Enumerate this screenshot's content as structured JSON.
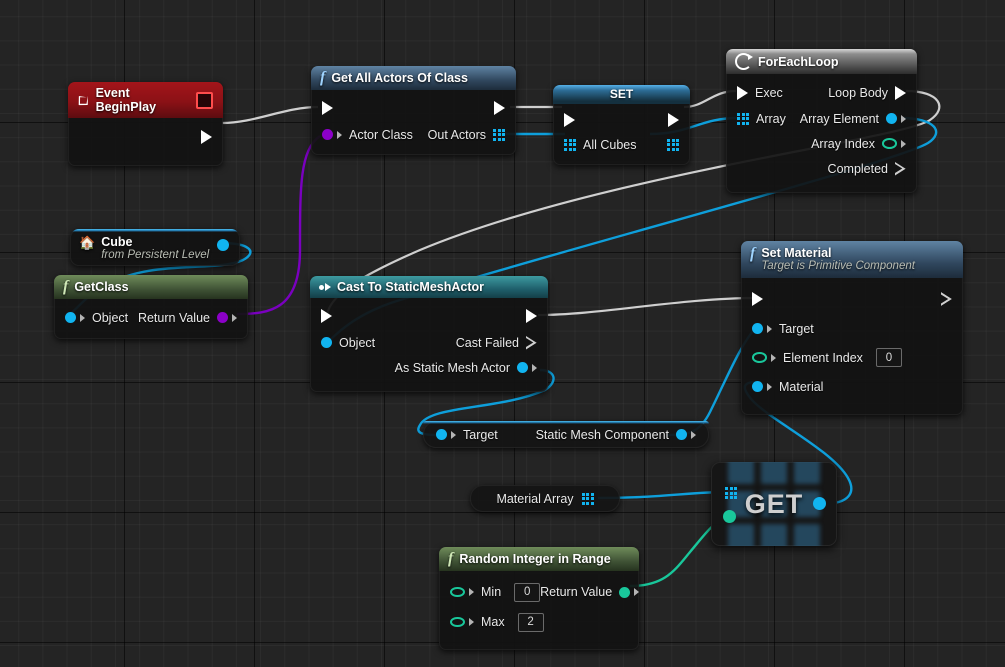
{
  "app": {
    "title": "Unreal Engine Blueprint Event Graph"
  },
  "nodes": {
    "event_begin_play": {
      "title": "Event BeginPlay",
      "icon": "event-diamond-icon",
      "breakpoint_icon": "stop-square-icon",
      "exec_out": ""
    },
    "get_all_actors": {
      "title": "Get All Actors Of Class",
      "icon": "function-f-icon",
      "inputs": [
        {
          "label": "Actor Class",
          "pin": "class-pin"
        }
      ],
      "outputs": [
        {
          "label": "Out Actors",
          "pin": "array-pin"
        }
      ]
    },
    "set_all_cubes": {
      "title": "SET",
      "var_label": "All Cubes",
      "pin": "array-pin"
    },
    "for_each_loop": {
      "title": "ForEachLoop",
      "icon": "loop-icon",
      "inputs": [
        {
          "label": "Exec",
          "pin": "exec-pin"
        },
        {
          "label": "Array",
          "pin": "array-pin"
        }
      ],
      "outputs": [
        {
          "label": "Loop Body",
          "pin": "exec-pin"
        },
        {
          "label": "Array Element",
          "pin": "object-pin"
        },
        {
          "label": "Array Index",
          "pin": "int-pin"
        },
        {
          "label": "Completed",
          "pin": "exec-pin"
        }
      ]
    },
    "cube_ref": {
      "title": "Cube",
      "subtitle": "from Persistent Level",
      "icon": "level-actor-icon",
      "out_pin": "object-pin"
    },
    "get_class": {
      "title": "GetClass",
      "icon": "function-f-icon",
      "inputs": [
        {
          "label": "Object",
          "pin": "object-pin"
        }
      ],
      "outputs": [
        {
          "label": "Return Value",
          "pin": "class-pin"
        }
      ]
    },
    "cast_node": {
      "title": "Cast To StaticMeshActor",
      "icon": "cast-icon",
      "inputs": [
        {
          "label": "Object",
          "pin": "object-pin"
        }
      ],
      "outputs": [
        {
          "label": "Cast Failed",
          "pin": "exec-pin-hollow"
        },
        {
          "label": "As Static Mesh Actor",
          "pin": "object-pin"
        }
      ]
    },
    "set_material": {
      "title": "Set Material",
      "subtitle": "Target is Primitive Component",
      "icon": "function-f-icon",
      "inputs": [
        {
          "label": "Target",
          "pin": "object-pin",
          "value": null
        },
        {
          "label": "Element Index",
          "pin": "int-pin",
          "value": "0"
        },
        {
          "label": "Material",
          "pin": "object-pin",
          "value": null
        }
      ]
    },
    "static_mesh_component": {
      "input_label": "Target",
      "output_label": "Static Mesh Component"
    },
    "material_array": {
      "label": "Material Array",
      "pin": "array-pin"
    },
    "get_array_item": {
      "title": "GET",
      "in_array_pin": "array-pin",
      "in_index_pin": "int-pin",
      "out_pin": "object-pin"
    },
    "random_int": {
      "title": "Random Integer in Range",
      "icon": "function-f-icon",
      "inputs": [
        {
          "label": "Min",
          "pin": "int-pin",
          "value": "0"
        },
        {
          "label": "Max",
          "pin": "int-pin",
          "value": "2"
        }
      ],
      "outputs": [
        {
          "label": "Return Value",
          "pin": "int-pin-filled"
        }
      ]
    }
  },
  "colors": {
    "exec_wire": "#cfcfcf",
    "object_wire": "#0e9fdb",
    "class_wire": "#7a00bf",
    "int_wire": "#19c79b",
    "background": "#242424"
  }
}
